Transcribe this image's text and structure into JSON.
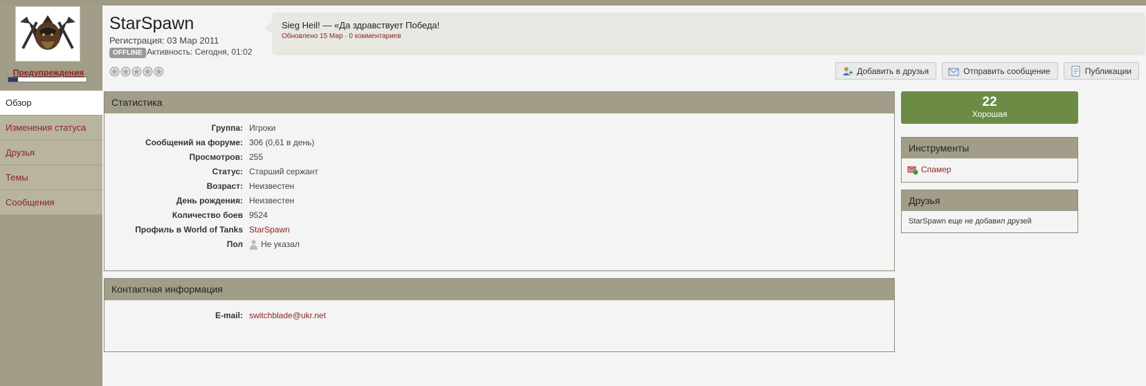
{
  "sidebar": {
    "warnings_label": "Предупреждения",
    "warning_level": 0.12,
    "nav": [
      {
        "label": "Обзор",
        "active": true
      },
      {
        "label": "Изменения статуса",
        "active": false
      },
      {
        "label": "Друзья",
        "active": false
      },
      {
        "label": "Темы",
        "active": false
      },
      {
        "label": "Сообщения",
        "active": false
      }
    ]
  },
  "profile": {
    "username": "StarSpawn",
    "registration": "Регистрация: 03 Мар 2011",
    "online_badge": "OFFLINE",
    "activity": "Активность: Сегодня, 01:02",
    "rating_stars": 0,
    "rating_max": 5
  },
  "status": {
    "text": "Sieg Heil! — «Да здравствует Победа!",
    "meta": "Обновлено 15 Мар · 0 комментариев"
  },
  "actions": {
    "add_friend": "Добавить в друзья",
    "send_message": "Отправить сообщение",
    "publications": "Публикации"
  },
  "stats": {
    "title": "Статистика",
    "rows": [
      {
        "key": "Группа:",
        "value": "Игроки"
      },
      {
        "key": "Сообщений на форуме:",
        "value": "306 (0,61 в день)"
      },
      {
        "key": "Просмотров:",
        "value": "255"
      },
      {
        "key": "Статус:",
        "value": "Старший сержант"
      },
      {
        "key": "Возраст:",
        "value": "Неизвестен"
      },
      {
        "key": "День рождения:",
        "value": "Неизвестен"
      },
      {
        "key": "Количество боев",
        "value": "9524"
      },
      {
        "key": "Профиль в World of Tanks",
        "value": "StarSpawn"
      },
      {
        "key": "Пол",
        "value": "Не указал"
      }
    ]
  },
  "contact": {
    "title": "Контактная информация",
    "email_key": "E-mail:",
    "email_value": "switchblade@ukr.net"
  },
  "reputation": {
    "value": "22",
    "label": "Хорошая"
  },
  "tools": {
    "title": "Инструменты",
    "spammer": "Спамер"
  },
  "friends": {
    "title": "Друзья",
    "empty": "StarSpawn еще не добавил друзей"
  },
  "colors": {
    "accent_link": "#8b2424",
    "header_bg": "#a29d88",
    "reputation_bg": "#6c8b45"
  }
}
